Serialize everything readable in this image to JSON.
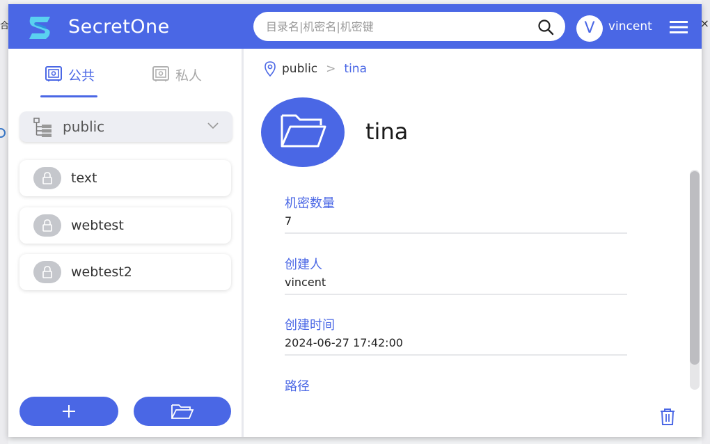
{
  "app": {
    "title": "SecretOne"
  },
  "search": {
    "placeholder": "目录名|机密名|机密键"
  },
  "user": {
    "initial": "V",
    "name": "vincent"
  },
  "sidebar": {
    "tabs": [
      {
        "label": "公共",
        "active": true
      },
      {
        "label": "私人",
        "active": false
      }
    ],
    "dropdown": {
      "selected": "public"
    },
    "items": [
      {
        "label": "text"
      },
      {
        "label": "webtest"
      },
      {
        "label": "webtest2"
      }
    ]
  },
  "breadcrumb": {
    "root": "public",
    "separator": ">",
    "current": "tina"
  },
  "detail": {
    "title": "tina",
    "fields": [
      {
        "label": "机密数量",
        "value": "7"
      },
      {
        "label": "创建人",
        "value": "vincent"
      },
      {
        "label": "创建时间",
        "value": "2024-06-27 17:42:00"
      },
      {
        "label": "路径",
        "value": ""
      }
    ]
  },
  "colors": {
    "accent": "#4a67e5",
    "lock_bg": "#c5c7cc",
    "dropdown_bg": "#edeef3"
  },
  "icons": [
    "logo-icon",
    "search-icon",
    "menu-icon",
    "safe-icon",
    "private-safe-icon",
    "tree-icon",
    "chevron-down-icon",
    "lock-icon",
    "plus-icon",
    "folder-icon",
    "location-pin-icon",
    "trash-icon"
  ]
}
